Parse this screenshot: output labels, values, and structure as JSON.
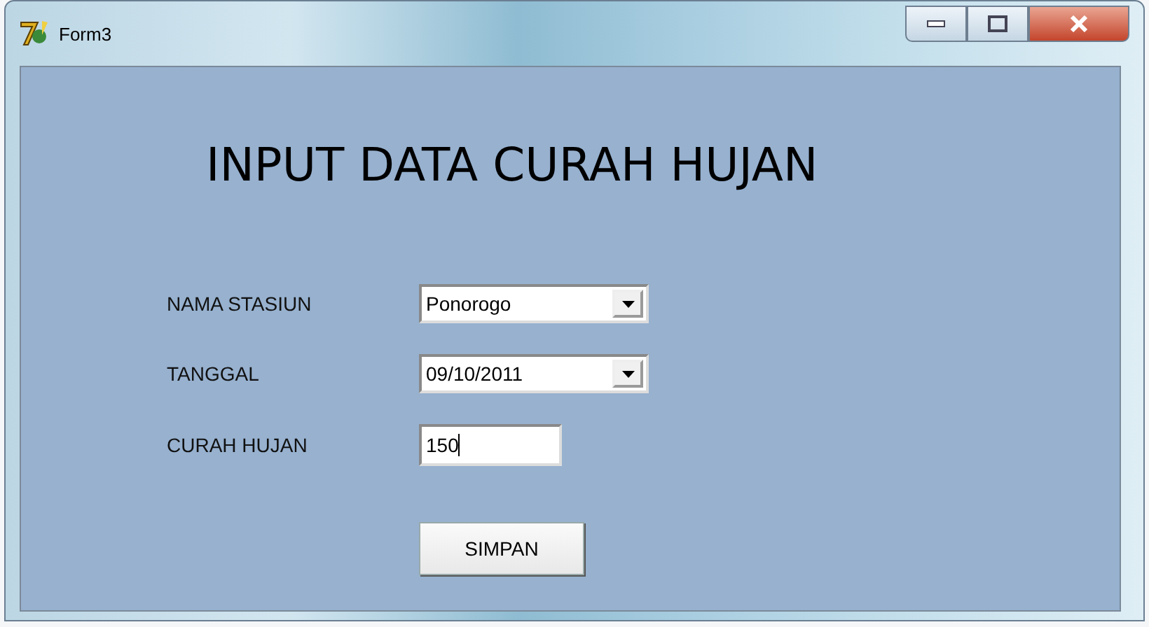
{
  "window": {
    "title": "Form3"
  },
  "heading": "INPUT DATA CURAH HUJAN",
  "fields": [
    {
      "kind": "dropdown",
      "label": "NAMA STASIUN",
      "value": "Ponorogo"
    },
    {
      "kind": "dropdown",
      "label": "TANGGAL",
      "value": "09/10/2011"
    },
    {
      "kind": "text",
      "label": "CURAH HUJAN",
      "value": "150"
    }
  ],
  "button": "SIMPAN"
}
